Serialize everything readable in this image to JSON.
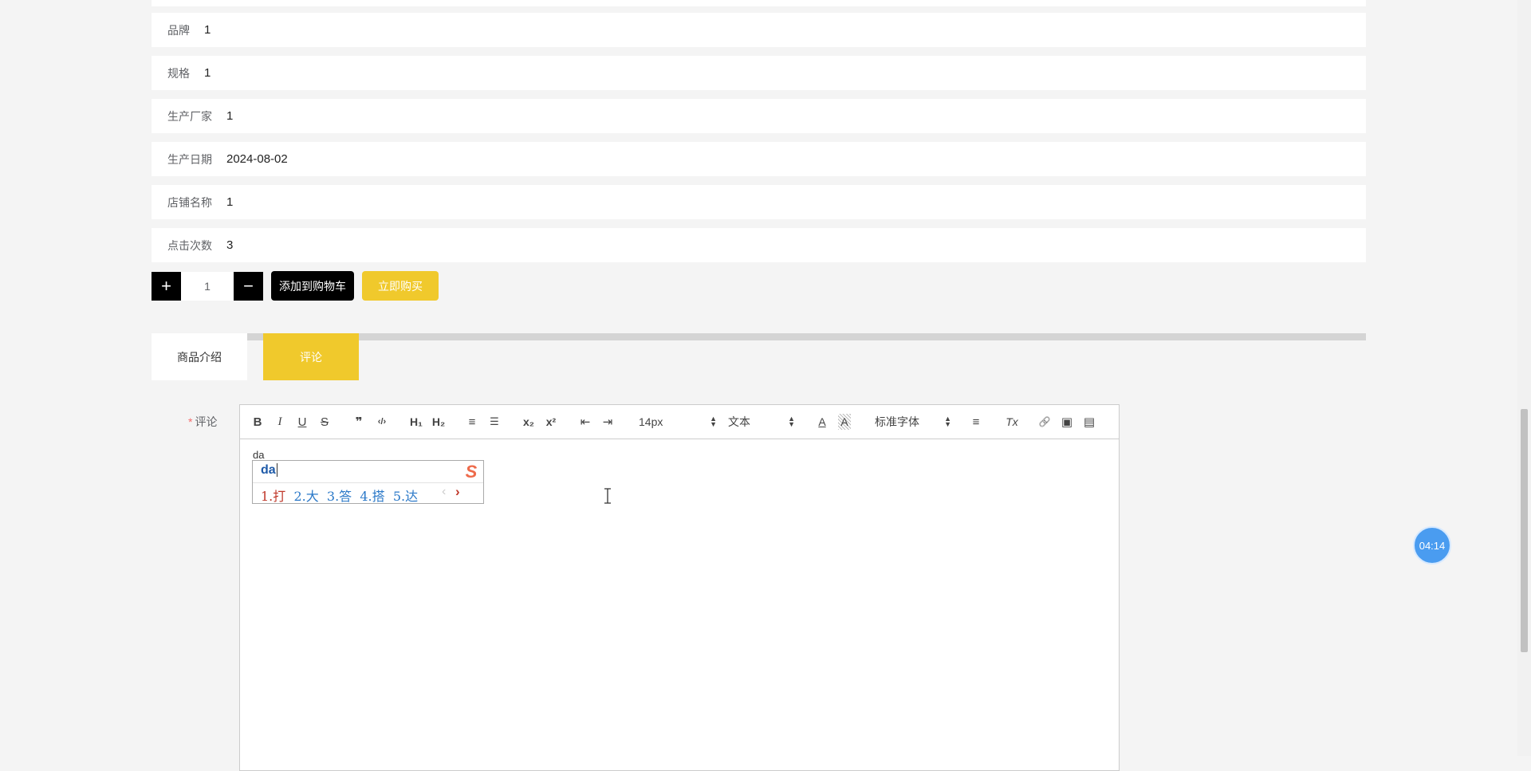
{
  "product_info": {
    "rows": [
      {
        "label": "品牌",
        "value": "1"
      },
      {
        "label": "规格",
        "value": "1"
      },
      {
        "label": "生产厂家",
        "value": "1"
      },
      {
        "label": "生产日期",
        "value": "2024-08-02"
      },
      {
        "label": "店铺名称",
        "value": "1"
      },
      {
        "label": "点击次数",
        "value": "3"
      }
    ]
  },
  "purchase": {
    "plus": "+",
    "quantity": "1",
    "minus": "−",
    "add_to_cart": "添加到购物车",
    "buy_now": "立即购买"
  },
  "tabs": [
    {
      "label": "商品介绍",
      "active": false
    },
    {
      "label": "评论",
      "active": true
    }
  ],
  "comment_form": {
    "required_mark": "*",
    "label": "评论",
    "toolbar": {
      "bold": "B",
      "italic": "I",
      "underline": "U",
      "strike": "S",
      "quote": "❞",
      "code": "‹/›",
      "h1": "H₁",
      "h2": "H₂",
      "ordered_list": "≡",
      "bullet_list": "☰",
      "subscript": "x₂",
      "superscript": "x²",
      "outdent": "⇤",
      "indent": "⇥",
      "font_size": "14px",
      "text_type": "文本",
      "font_color": "A",
      "background_color": "A",
      "font_family": "标准字体",
      "align": "≡",
      "clean": "Tx",
      "link": "🔗",
      "image": "▣",
      "video": "▤"
    },
    "content": "da"
  },
  "ime": {
    "input": "da",
    "candidates": [
      "1.打",
      "2.大",
      "3.答",
      "4.搭",
      "5.达"
    ],
    "prev": "‹",
    "next": "›",
    "logo": "S"
  },
  "timer": "04:14",
  "colors": {
    "accent_yellow": "#f0c92c",
    "black_button": "#000000",
    "timer_blue": "#4a9cf0"
  }
}
